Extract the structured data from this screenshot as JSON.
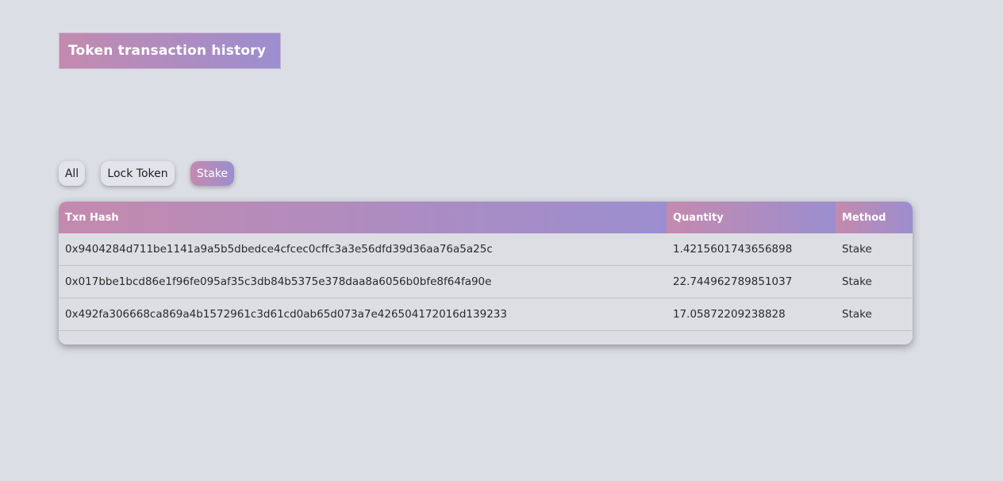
{
  "header": {
    "title": "Token transaction history"
  },
  "filters": {
    "items": [
      {
        "label": "All",
        "active": false
      },
      {
        "label": "Lock Token",
        "active": false
      },
      {
        "label": "Stake",
        "active": true
      }
    ]
  },
  "table": {
    "columns": [
      "Txn Hash",
      "Quantity",
      "Method"
    ],
    "rows": [
      {
        "hash": "0x9404284d711be1141a9a5b5dbedce4cfcec0cffc3a3e56dfd39d36aa76a5a25c",
        "quantity": "1.4215601743656898",
        "method": "Stake"
      },
      {
        "hash": "0x017bbe1bcd86e1f96fe095af35c3db84b5375e378daa8a6056b0bfe8f64fa90e",
        "quantity": "22.744962789851037",
        "method": "Stake"
      },
      {
        "hash": "0x492fa306668ca869a4b1572961c3d61cd0ab65d073a7e426504172016d139233",
        "quantity": "17.05872209238828",
        "method": "Stake"
      }
    ]
  },
  "colors": {
    "background": "#dcdee6",
    "gradient_start": "#c48aae",
    "gradient_end": "#9b8ed0"
  }
}
